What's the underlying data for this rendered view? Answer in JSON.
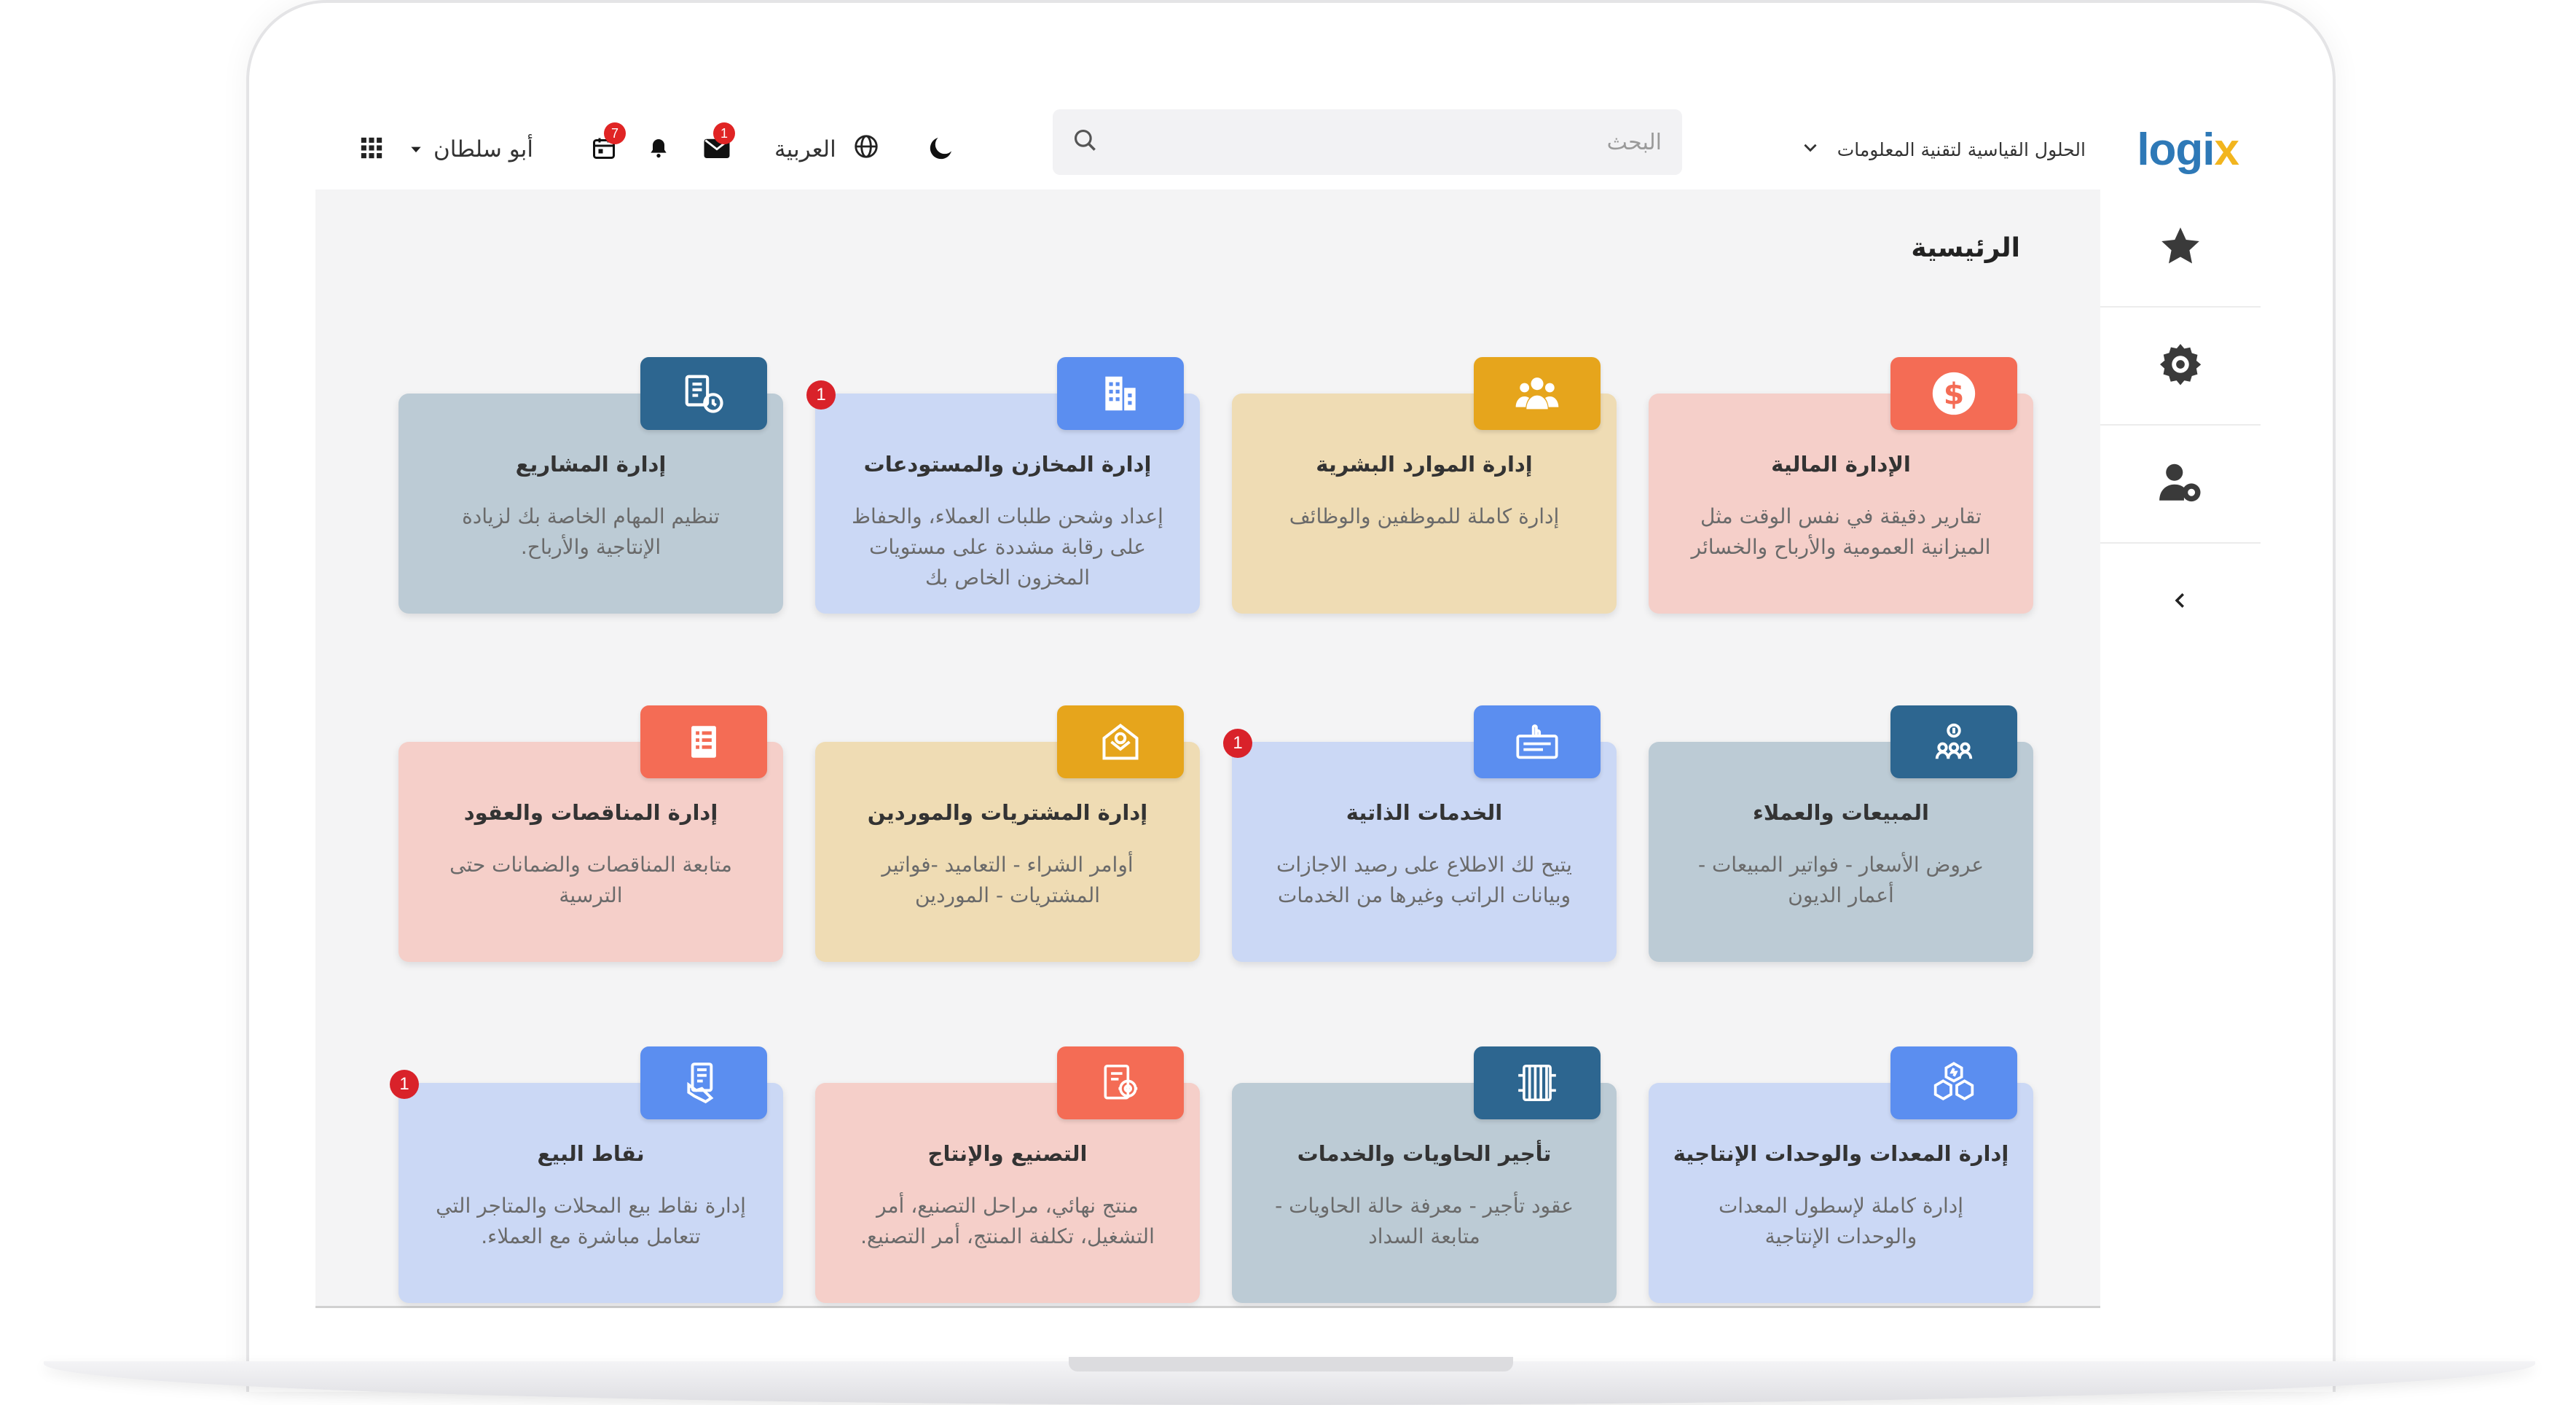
{
  "colors": {
    "logo_blue": "#2e79b7",
    "logo_yellow": "#f2b51e",
    "badge_red": "#d9222a",
    "pink_card": "#f5cfc9",
    "blue_card": "#cbd8f5",
    "yellow_card": "#efdcb4",
    "grey_card": "#bccbd5"
  },
  "header": {
    "logo_main": "logi",
    "logo_x": "x",
    "company_name": "الحلول القياسية لتقنية المعلومات",
    "search_placeholder": "البحث",
    "language": "العربية",
    "messages_badge": "1",
    "calendar_badge": "7",
    "user_name": "أبو سلطان",
    "icons": [
      "moon-icon",
      "globe-icon",
      "mail-icon",
      "bell-icon",
      "calendar-icon",
      "apps-grid-icon",
      "search-icon"
    ]
  },
  "sidebar": {
    "items": [
      "star-icon",
      "settings-gear-icon",
      "user-settings-icon"
    ],
    "collapse": "‹"
  },
  "main": {
    "title": "الرئيسية",
    "cards": [
      {
        "title": "الإدارة المالية",
        "desc": "تقارير دقيقة في نفس الوقت مثل الميزانية العمومية والأرباح والخسائر",
        "icon": "dollar-icon",
        "badge": ""
      },
      {
        "title": "إدارة الموارد البشرية",
        "desc": "إدارة كاملة للموظفين والوظائف",
        "icon": "people-icon",
        "badge": ""
      },
      {
        "title": "إدارة المخازن والمستودعات",
        "desc": "إعداد وشحن طلبات العملاء، والحفاظ على رقابة مشددة على مستويات المخزون الخاص بك",
        "icon": "warehouse-icon",
        "badge": "1"
      },
      {
        "title": "إدارة المشاريع",
        "desc": "تنظيم المهام الخاصة بك لزيادة الإنتاجية والأرباح.",
        "icon": "project-icon",
        "badge": ""
      },
      {
        "title": "المبيعات والعملاء",
        "desc": "عروض الأسعار - فواتير المبيعات - أعمار الديون",
        "icon": "customers-icon",
        "badge": ""
      },
      {
        "title": "الخدمات الذاتية",
        "desc": "يتيح لك الاطلاع على رصيد الاجازات وبيانات الراتب وغيرها من الخدمات",
        "icon": "self-service-icon",
        "badge": "1"
      },
      {
        "title": "إدارة المشتريات والموردين",
        "desc": "أوامر الشراء - التعاميد -فواتير المشتريات - الموردين",
        "icon": "purchase-icon",
        "badge": ""
      },
      {
        "title": "إدارة المناقصات والعقود",
        "desc": "متابعة المناقصات والضمانات حتى الترسية",
        "icon": "tender-icon",
        "badge": ""
      },
      {
        "title": "إدارة المعدات والوحدات الإنتاجية",
        "desc": "إدارة كاملة لإسطول المعدات والوحدات الإنتاجية",
        "icon": "equipment-icon",
        "badge": ""
      },
      {
        "title": "تأجير الحاويات والخدمات",
        "desc": "عقود تأجير - معرفة حالة الحاويات - متابعة السداد",
        "icon": "container-icon",
        "badge": ""
      },
      {
        "title": "التصنيع والإنتاج",
        "desc": "منتج نهائي، مراحل التصنيع، أمر التشغيل، تكلفة المنتج، أمر التصنيع.",
        "icon": "manufacturing-icon",
        "badge": ""
      },
      {
        "title": "نقاط البيع",
        "desc": "إدارة نقاط بيع المحلات والمتاجر التي تتعامل مباشرة مع العملاء.",
        "icon": "pos-icon",
        "badge": "1"
      }
    ]
  }
}
